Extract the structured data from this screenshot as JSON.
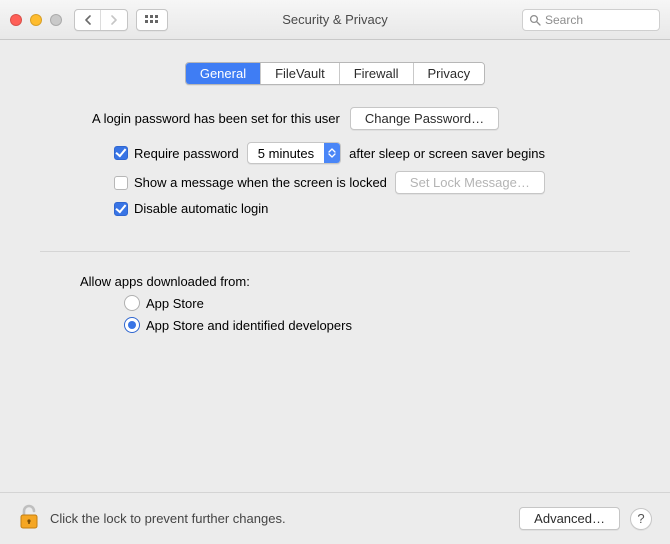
{
  "header": {
    "title": "Security & Privacy",
    "search_placeholder": "Search"
  },
  "tabs": {
    "items": [
      "General",
      "FileVault",
      "Firewall",
      "Privacy"
    ],
    "selected": 0
  },
  "general": {
    "login_password_text": "A login password has been set for this user",
    "change_password_label": "Change Password…",
    "require_password_prefix": "Require password",
    "require_password_checked": true,
    "require_password_delay": "5 minutes",
    "require_password_suffix": "after sleep or screen saver begins",
    "show_message_label": "Show a message when the screen is locked",
    "show_message_checked": false,
    "set_lock_message_label": "Set Lock Message…",
    "disable_autologin_label": "Disable automatic login",
    "disable_autologin_checked": true
  },
  "allow_apps": {
    "heading": "Allow apps downloaded from:",
    "options": [
      {
        "label": "App Store",
        "selected": false
      },
      {
        "label": "App Store and identified developers",
        "selected": true
      }
    ]
  },
  "footer": {
    "lock_text": "Click the lock to prevent further changes.",
    "advanced_label": "Advanced…",
    "help_label": "?"
  }
}
